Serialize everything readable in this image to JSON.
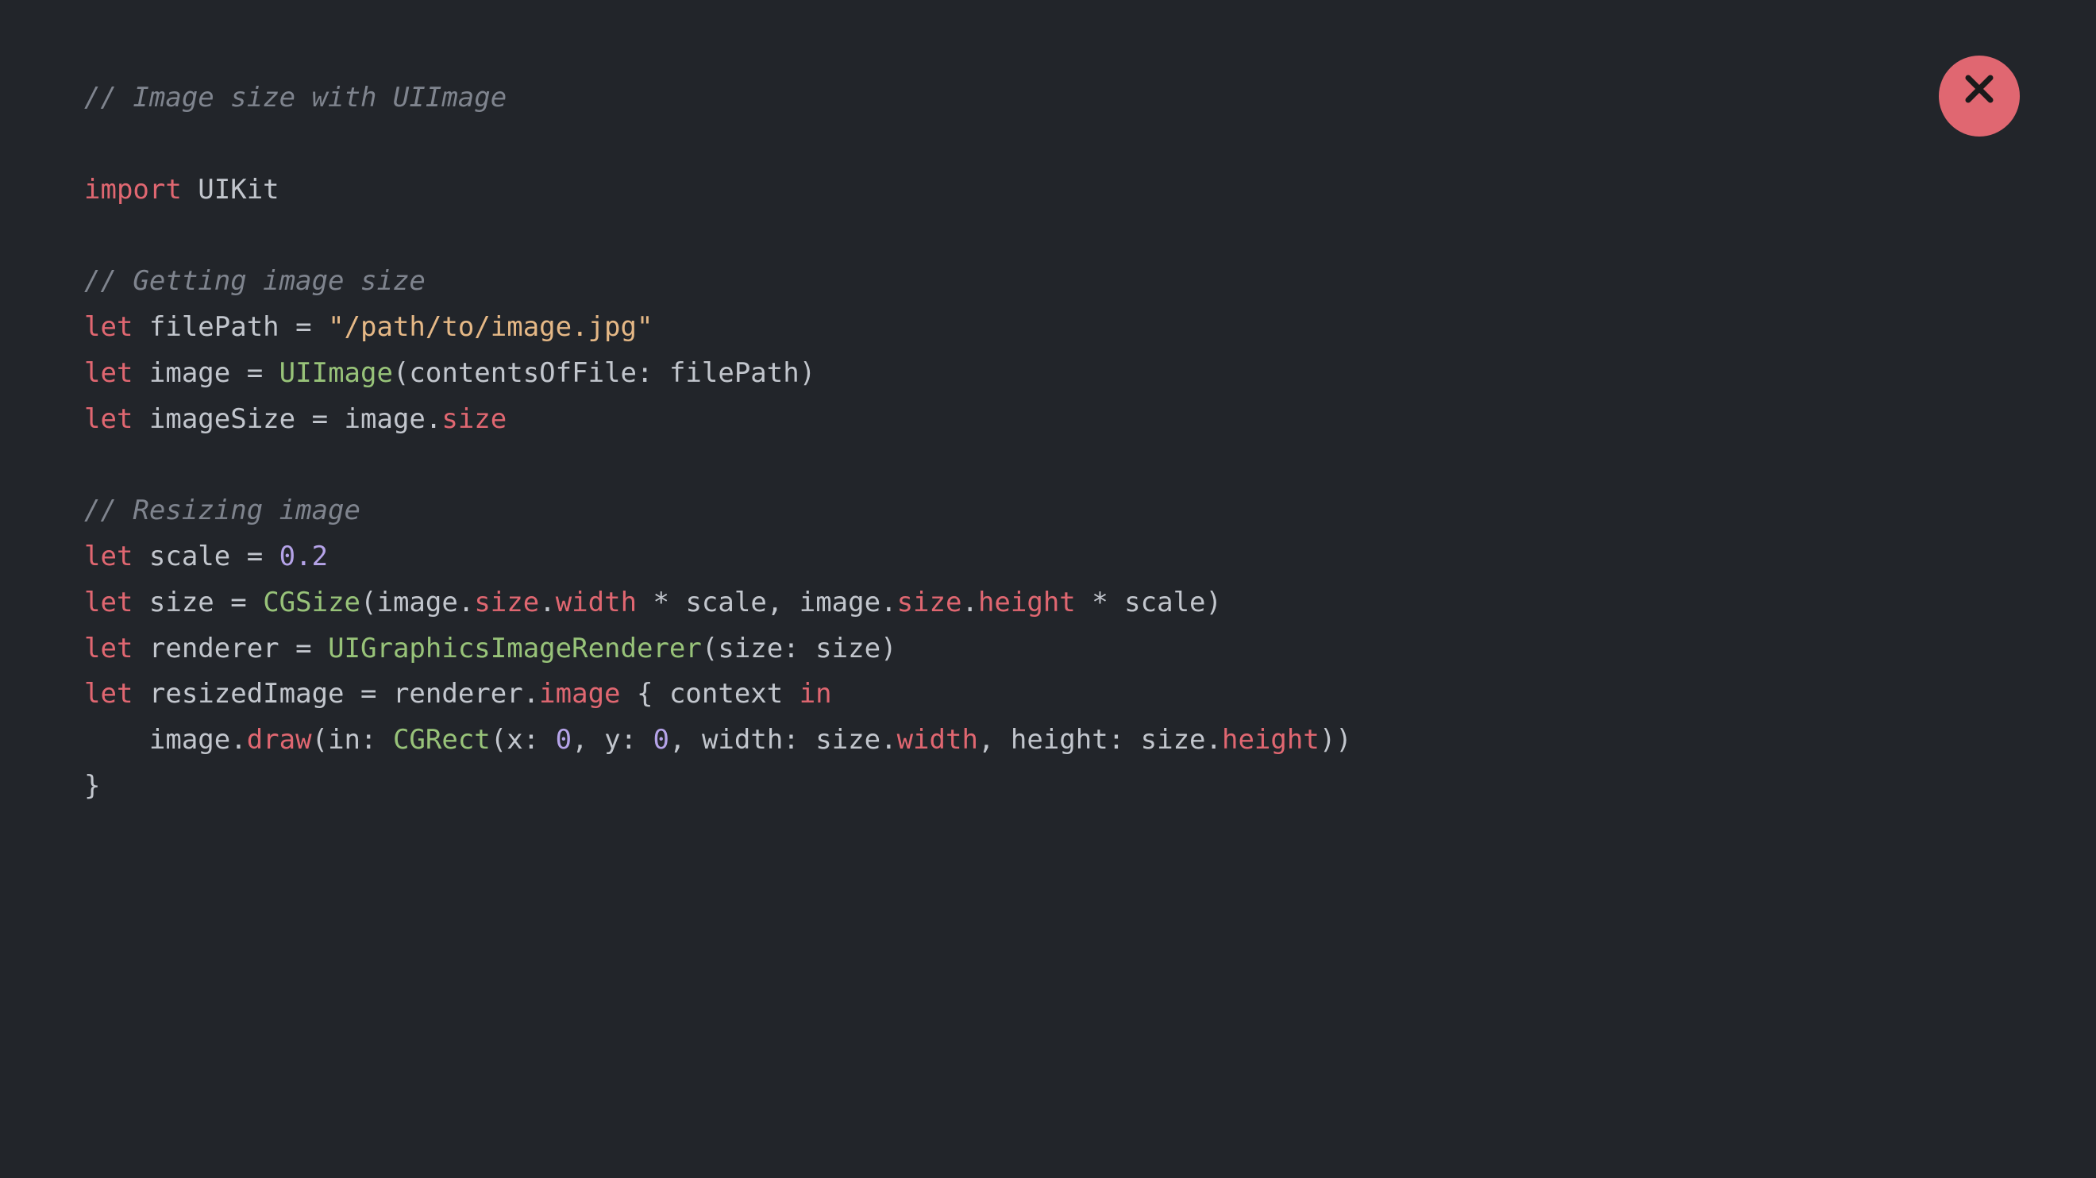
{
  "closeButton": {
    "iconName": "close-icon"
  },
  "code": {
    "lines": [
      {
        "tokens": [
          {
            "cls": "tok-comment",
            "text": "// Image size with UIImage"
          }
        ]
      },
      {
        "tokens": []
      },
      {
        "tokens": [
          {
            "cls": "tok-keyword",
            "text": "import"
          },
          {
            "cls": "tok-default",
            "text": " UIKit"
          }
        ]
      },
      {
        "tokens": []
      },
      {
        "tokens": [
          {
            "cls": "tok-comment",
            "text": "// Getting image size"
          }
        ]
      },
      {
        "tokens": [
          {
            "cls": "tok-keyword",
            "text": "let"
          },
          {
            "cls": "tok-default",
            "text": " filePath = "
          },
          {
            "cls": "tok-string",
            "text": "\"/path/to/image.jpg\""
          }
        ]
      },
      {
        "tokens": [
          {
            "cls": "tok-keyword",
            "text": "let"
          },
          {
            "cls": "tok-default",
            "text": " image = "
          },
          {
            "cls": "tok-type",
            "text": "UIImage"
          },
          {
            "cls": "tok-default",
            "text": "(contentsOfFile: filePath)"
          }
        ]
      },
      {
        "tokens": [
          {
            "cls": "tok-keyword",
            "text": "let"
          },
          {
            "cls": "tok-default",
            "text": " imageSize = image."
          },
          {
            "cls": "tok-prop",
            "text": "size"
          }
        ]
      },
      {
        "tokens": []
      },
      {
        "tokens": [
          {
            "cls": "tok-comment",
            "text": "// Resizing image"
          }
        ]
      },
      {
        "tokens": [
          {
            "cls": "tok-keyword",
            "text": "let"
          },
          {
            "cls": "tok-default",
            "text": " scale = "
          },
          {
            "cls": "tok-number",
            "text": "0.2"
          }
        ]
      },
      {
        "tokens": [
          {
            "cls": "tok-keyword",
            "text": "let"
          },
          {
            "cls": "tok-default",
            "text": " size = "
          },
          {
            "cls": "tok-type",
            "text": "CGSize"
          },
          {
            "cls": "tok-default",
            "text": "(image."
          },
          {
            "cls": "tok-prop",
            "text": "size"
          },
          {
            "cls": "tok-default",
            "text": "."
          },
          {
            "cls": "tok-prop",
            "text": "width"
          },
          {
            "cls": "tok-default",
            "text": " * scale, image."
          },
          {
            "cls": "tok-prop",
            "text": "size"
          },
          {
            "cls": "tok-default",
            "text": "."
          },
          {
            "cls": "tok-prop",
            "text": "height"
          },
          {
            "cls": "tok-default",
            "text": " * scale)"
          }
        ]
      },
      {
        "tokens": [
          {
            "cls": "tok-keyword",
            "text": "let"
          },
          {
            "cls": "tok-default",
            "text": " renderer = "
          },
          {
            "cls": "tok-type",
            "text": "UIGraphicsImageRenderer"
          },
          {
            "cls": "tok-default",
            "text": "(size: size)"
          }
        ]
      },
      {
        "tokens": [
          {
            "cls": "tok-keyword",
            "text": "let"
          },
          {
            "cls": "tok-default",
            "text": " resizedImage = renderer."
          },
          {
            "cls": "tok-prop",
            "text": "image"
          },
          {
            "cls": "tok-default",
            "text": " { context "
          },
          {
            "cls": "tok-keyword",
            "text": "in"
          }
        ]
      },
      {
        "tokens": [
          {
            "cls": "tok-default",
            "text": "    image."
          },
          {
            "cls": "tok-prop",
            "text": "draw"
          },
          {
            "cls": "tok-default",
            "text": "(in: "
          },
          {
            "cls": "tok-type",
            "text": "CGRect"
          },
          {
            "cls": "tok-default",
            "text": "(x: "
          },
          {
            "cls": "tok-number",
            "text": "0"
          },
          {
            "cls": "tok-default",
            "text": ", y: "
          },
          {
            "cls": "tok-number",
            "text": "0"
          },
          {
            "cls": "tok-default",
            "text": ", width: size."
          },
          {
            "cls": "tok-prop",
            "text": "width"
          },
          {
            "cls": "tok-default",
            "text": ", height: size."
          },
          {
            "cls": "tok-prop",
            "text": "height"
          },
          {
            "cls": "tok-default",
            "text": "))"
          }
        ]
      },
      {
        "tokens": [
          {
            "cls": "tok-default",
            "text": "}"
          }
        ]
      }
    ]
  }
}
